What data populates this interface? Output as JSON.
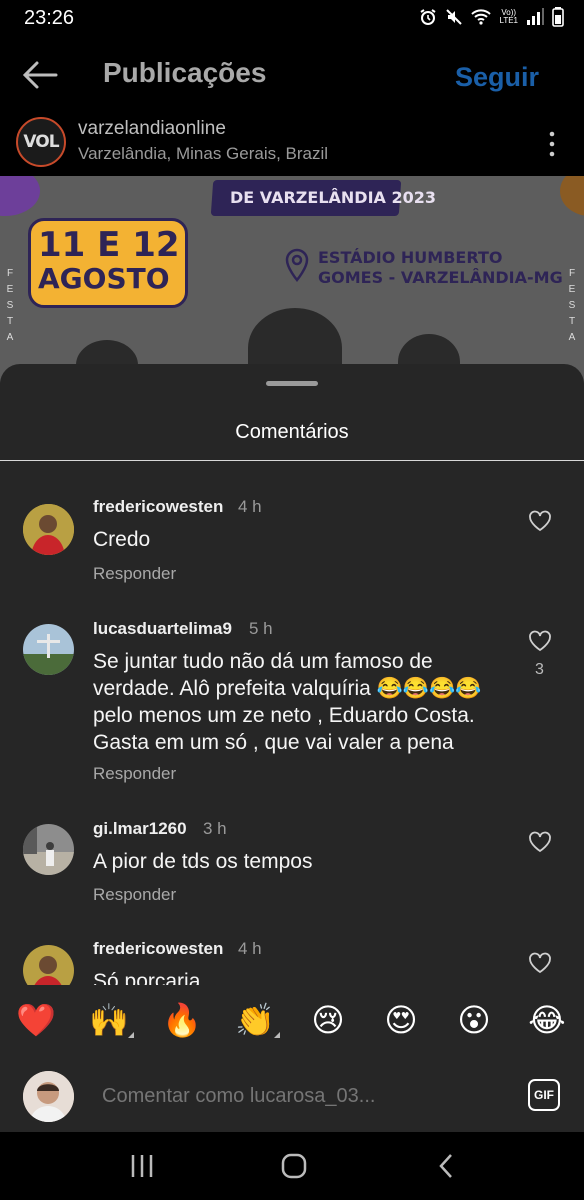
{
  "status_bar": {
    "time": "23:26",
    "network": "Vo))\nLTE1"
  },
  "header": {
    "title": "Publicações",
    "follow_label": "Seguir"
  },
  "post": {
    "avatar_text": "VOL",
    "username": "varzelandiaonline",
    "location": "Varzelândia, Minas Gerais, Brazil",
    "poster": {
      "banner": "DE VARZELÂNDIA 2023",
      "dates_line1": "11 E 12",
      "dates_line2": "AGOSTO",
      "venue_line1": "ESTÁDIO HUMBERTO",
      "venue_line2": "GOMES - VARZELÂNDIA-MG",
      "side_text": "FESTA"
    }
  },
  "comments_sheet": {
    "title": "Comentários",
    "comments": [
      {
        "username": "fredericowesten",
        "time": "4 h",
        "text": "Credo",
        "reply": "Responder",
        "likes": ""
      },
      {
        "username": "lucasduartelima9",
        "time": "5 h",
        "text": "Se juntar  tudo não dá um famoso de verdade.  Alô prefeita valquíria 😂😂😂😂 pelo menos um ze neto , Eduardo Costa. Gasta em um só , que vai valer a pena",
        "reply": "Responder",
        "likes": "3"
      },
      {
        "username": "gi.lmar1260",
        "time": "3 h",
        "text": "A pior de tds os tempos",
        "reply": "Responder",
        "likes": ""
      },
      {
        "username": "fredericowesten",
        "time": "4 h",
        "text": "Só porcaria",
        "reply": "",
        "likes": ""
      }
    ]
  },
  "reactions": [
    "❤️",
    "🙌",
    "🔥",
    "👏",
    "😢",
    "😍",
    "😮",
    "😂"
  ],
  "composer": {
    "placeholder": "Comentar como lucarosa_03...",
    "gif_label": "GIF"
  },
  "colors": {
    "accent": "#1a5fa8",
    "sheet_bg": "#262626",
    "background": "#000000"
  }
}
